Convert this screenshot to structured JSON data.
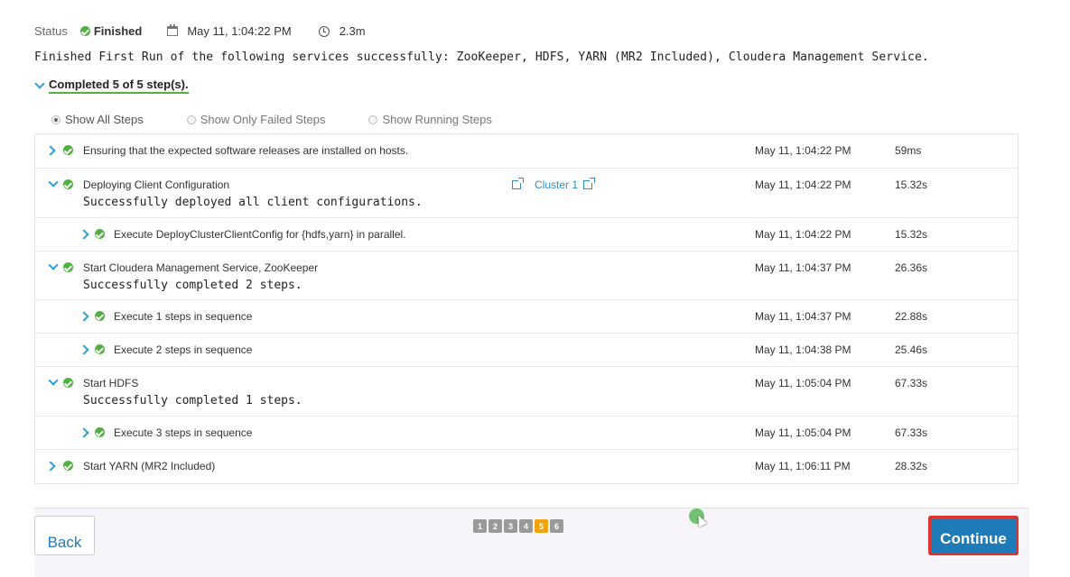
{
  "status": {
    "label": "Status",
    "state": "Finished",
    "date": "May 11, 1:04:22 PM",
    "duration": "2.3m"
  },
  "summary": "Finished First Run of the following services successfully: ZooKeeper, HDFS, YARN (MR2 Included), Cloudera Management Service.",
  "completed": "Completed 5 of 5 step(s).",
  "filters": {
    "all": "Show All Steps",
    "failed": "Show Only Failed Steps",
    "running": "Show Running Steps"
  },
  "steps": [
    {
      "title": "Ensuring that the expected software releases are installed on hosts.",
      "time": "May 11, 1:04:22 PM",
      "duration": "59ms"
    },
    {
      "title": "Deploying Client Configuration",
      "desc": "Successfully deployed all client configurations.",
      "link": "Cluster 1",
      "time": "May 11, 1:04:22 PM",
      "duration": "15.32s"
    },
    {
      "title": "Execute DeployClusterClientConfig for {hdfs,yarn} in parallel.",
      "time": "May 11, 1:04:22 PM",
      "duration": "15.32s"
    },
    {
      "title": "Start Cloudera Management Service, ZooKeeper",
      "desc": "Successfully completed 2 steps.",
      "time": "May 11, 1:04:37 PM",
      "duration": "26.36s"
    },
    {
      "title": "Execute 1 steps in sequence",
      "time": "May 11, 1:04:37 PM",
      "duration": "22.88s"
    },
    {
      "title": "Execute 2 steps in sequence",
      "time": "May 11, 1:04:38 PM",
      "duration": "25.46s"
    },
    {
      "title": "Start HDFS",
      "desc": "Successfully completed 1 steps.",
      "time": "May 11, 1:05:04 PM",
      "duration": "67.33s"
    },
    {
      "title": "Execute 3 steps in sequence",
      "time": "May 11, 1:05:04 PM",
      "duration": "67.33s"
    },
    {
      "title": "Start YARN (MR2 Included)",
      "time": "May 11, 1:06:11 PM",
      "duration": "28.32s"
    }
  ],
  "footer": {
    "back": "Back",
    "continue": "Continue",
    "pages": [
      "1",
      "2",
      "3",
      "4",
      "5",
      "6"
    ],
    "active_page": "5"
  },
  "colors": {
    "success": "#52b043",
    "accent": "#2a9fd6",
    "primary_button": "#1f7ab8",
    "active_page": "#f0a30a",
    "highlight": "#e0332e"
  }
}
